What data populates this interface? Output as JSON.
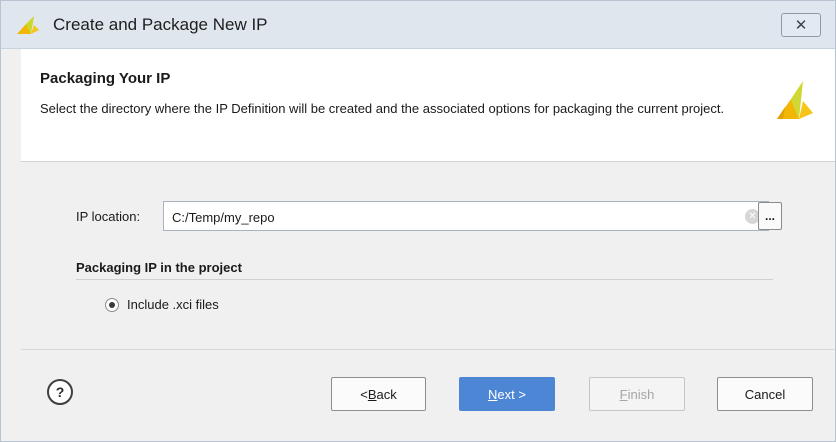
{
  "window": {
    "title": "Create and Package New IP",
    "close_icon": "close-icon",
    "app_icon": "vivado-logo-icon"
  },
  "header": {
    "title": "Packaging Your IP",
    "description": "Select the directory where the IP Definition will be created and the associated options for packaging the current project."
  },
  "form": {
    "ip_location_label": "IP location:",
    "ip_location_value": "C:/Temp/my_repo",
    "browse_label": "...",
    "section_title": "Packaging IP in the project",
    "radio_label": "Include .xci files",
    "radio_selected": true
  },
  "footer": {
    "help_label": "?",
    "back": {
      "pre": "< ",
      "mnemonic": "B",
      "rest": "ack"
    },
    "next": {
      "mnemonic": "N",
      "rest": "ext >"
    },
    "finish": {
      "mnemonic": "F",
      "rest": "inish"
    },
    "cancel": "Cancel"
  },
  "colors": {
    "primary_button": "#4e86d6",
    "title_bar": "#dfe6ee",
    "logo": "#f0c419"
  }
}
